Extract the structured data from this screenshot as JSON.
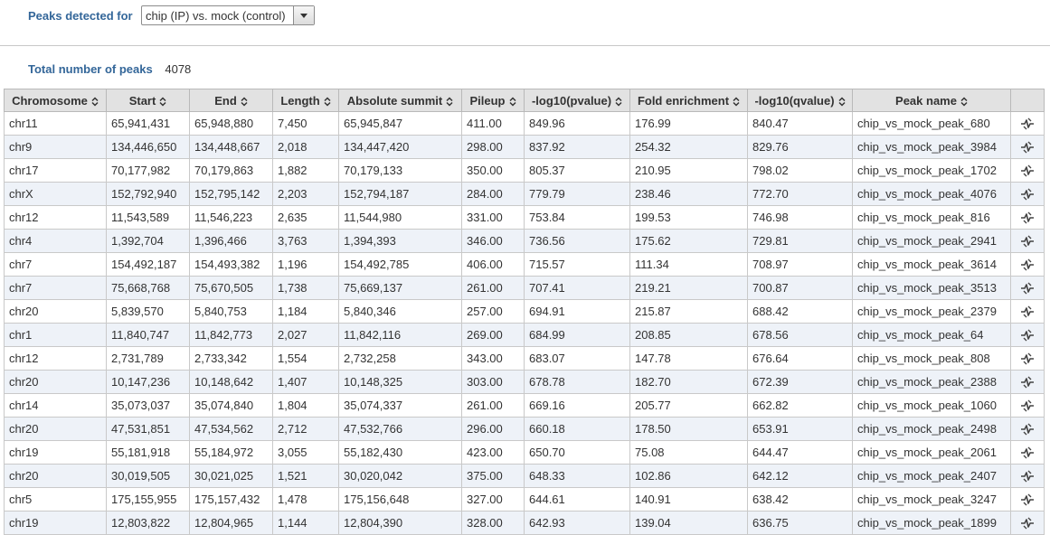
{
  "header": {
    "peaks_label": "Peaks detected for",
    "comparison_selected": "chip (IP) vs. mock (control)"
  },
  "summary": {
    "total_label": "Total number of peaks",
    "total_value": "4078"
  },
  "table": {
    "columns": [
      "Chromosome",
      "Start",
      "End",
      "Length",
      "Absolute summit",
      "Pileup",
      "-log10(pvalue)",
      "Fold enrichment",
      "-log10(qvalue)",
      "Peak name"
    ],
    "rows": [
      [
        "chr11",
        "65,941,431",
        "65,948,880",
        "7,450",
        "65,945,847",
        "411.00",
        "849.96",
        "176.99",
        "840.47",
        "chip_vs_mock_peak_680"
      ],
      [
        "chr9",
        "134,446,650",
        "134,448,667",
        "2,018",
        "134,447,420",
        "298.00",
        "837.92",
        "254.32",
        "829.76",
        "chip_vs_mock_peak_3984"
      ],
      [
        "chr17",
        "70,177,982",
        "70,179,863",
        "1,882",
        "70,179,133",
        "350.00",
        "805.37",
        "210.95",
        "798.02",
        "chip_vs_mock_peak_1702"
      ],
      [
        "chrX",
        "152,792,940",
        "152,795,142",
        "2,203",
        "152,794,187",
        "284.00",
        "779.79",
        "238.46",
        "772.70",
        "chip_vs_mock_peak_4076"
      ],
      [
        "chr12",
        "11,543,589",
        "11,546,223",
        "2,635",
        "11,544,980",
        "331.00",
        "753.84",
        "199.53",
        "746.98",
        "chip_vs_mock_peak_816"
      ],
      [
        "chr4",
        "1,392,704",
        "1,396,466",
        "3,763",
        "1,394,393",
        "346.00",
        "736.56",
        "175.62",
        "729.81",
        "chip_vs_mock_peak_2941"
      ],
      [
        "chr7",
        "154,492,187",
        "154,493,382",
        "1,196",
        "154,492,785",
        "406.00",
        "715.57",
        "111.34",
        "708.97",
        "chip_vs_mock_peak_3614"
      ],
      [
        "chr7",
        "75,668,768",
        "75,670,505",
        "1,738",
        "75,669,137",
        "261.00",
        "707.41",
        "219.21",
        "700.87",
        "chip_vs_mock_peak_3513"
      ],
      [
        "chr20",
        "5,839,570",
        "5,840,753",
        "1,184",
        "5,840,346",
        "257.00",
        "694.91",
        "215.87",
        "688.42",
        "chip_vs_mock_peak_2379"
      ],
      [
        "chr1",
        "11,840,747",
        "11,842,773",
        "2,027",
        "11,842,116",
        "269.00",
        "684.99",
        "208.85",
        "678.56",
        "chip_vs_mock_peak_64"
      ],
      [
        "chr12",
        "2,731,789",
        "2,733,342",
        "1,554",
        "2,732,258",
        "343.00",
        "683.07",
        "147.78",
        "676.64",
        "chip_vs_mock_peak_808"
      ],
      [
        "chr20",
        "10,147,236",
        "10,148,642",
        "1,407",
        "10,148,325",
        "303.00",
        "678.78",
        "182.70",
        "672.39",
        "chip_vs_mock_peak_2388"
      ],
      [
        "chr14",
        "35,073,037",
        "35,074,840",
        "1,804",
        "35,074,337",
        "261.00",
        "669.16",
        "205.77",
        "662.82",
        "chip_vs_mock_peak_1060"
      ],
      [
        "chr20",
        "47,531,851",
        "47,534,562",
        "2,712",
        "47,532,766",
        "296.00",
        "660.18",
        "178.50",
        "653.91",
        "chip_vs_mock_peak_2498"
      ],
      [
        "chr19",
        "55,181,918",
        "55,184,972",
        "3,055",
        "55,182,430",
        "423.00",
        "650.70",
        "75.08",
        "644.47",
        "chip_vs_mock_peak_2061"
      ],
      [
        "chr20",
        "30,019,505",
        "30,021,025",
        "1,521",
        "30,020,042",
        "375.00",
        "648.33",
        "102.86",
        "642.12",
        "chip_vs_mock_peak_2407"
      ],
      [
        "chr5",
        "175,155,955",
        "175,157,432",
        "1,478",
        "175,156,648",
        "327.00",
        "644.61",
        "140.91",
        "638.42",
        "chip_vs_mock_peak_3247"
      ],
      [
        "chr19",
        "12,803,822",
        "12,804,965",
        "1,144",
        "12,804,390",
        "328.00",
        "642.93",
        "139.04",
        "636.75",
        "chip_vs_mock_peak_1899"
      ]
    ],
    "row_action_icon": "view-peak-icon",
    "sort_icon": "sort-up-down-icon"
  }
}
